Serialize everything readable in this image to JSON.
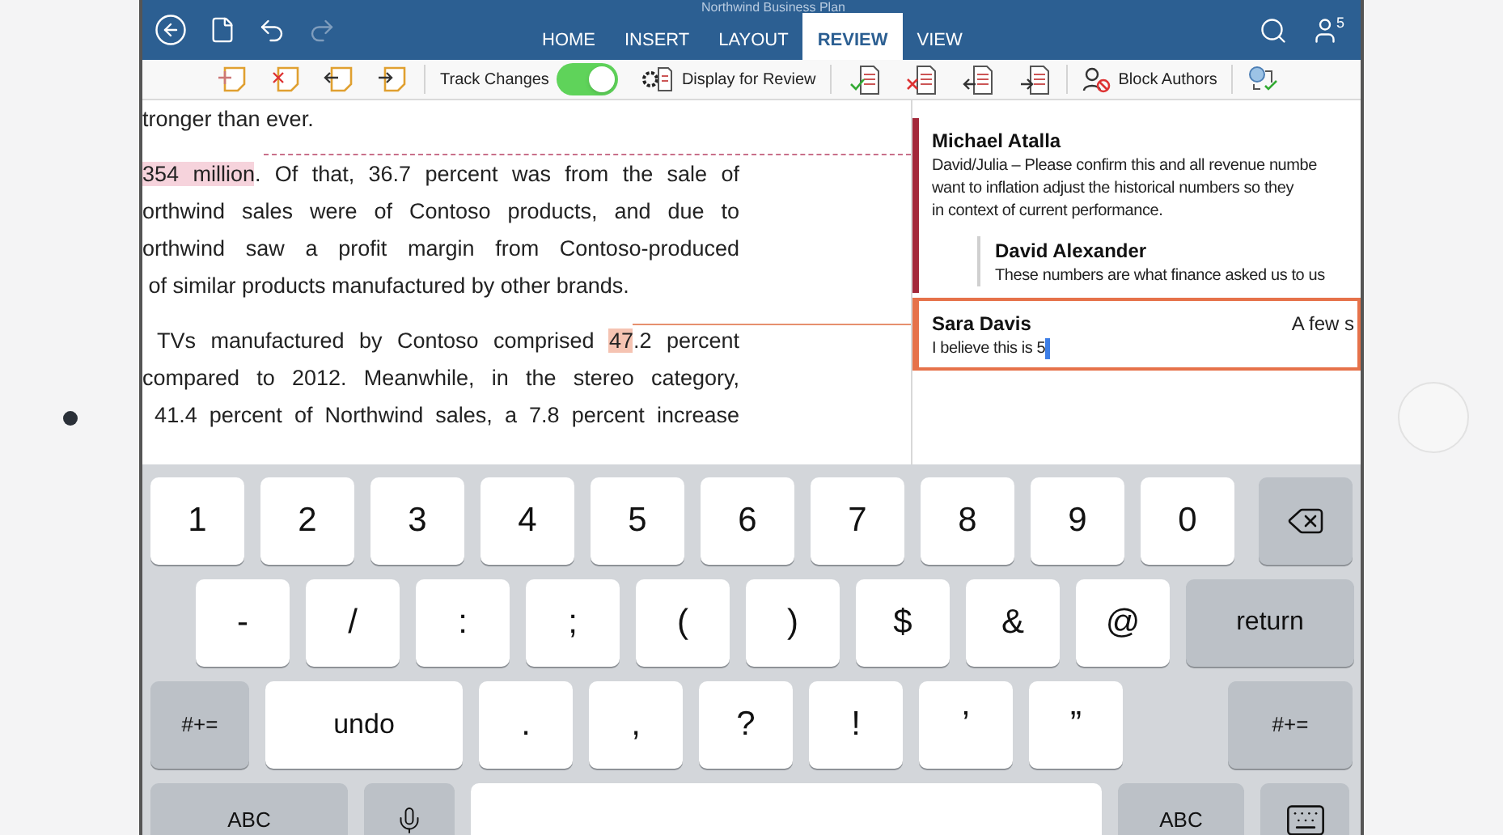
{
  "window": {
    "title": "Northwind Business Plan",
    "collaborators_count": "5"
  },
  "tabs": [
    {
      "label": "HOME",
      "selected": false
    },
    {
      "label": "INSERT",
      "selected": false
    },
    {
      "label": "LAYOUT",
      "selected": false
    },
    {
      "label": "REVIEW",
      "selected": true
    },
    {
      "label": "VIEW",
      "selected": false
    }
  ],
  "ribbon": {
    "track_changes": {
      "label": "Track Changes",
      "on": true
    },
    "display_for_review": {
      "label": "Display for Review"
    },
    "block_authors": {
      "label": "Block Authors"
    }
  },
  "document": {
    "paragraphs": [
      {
        "ends": true,
        "lines": [
          [
            {
              "text": "tronger than ever."
            }
          ]
        ]
      },
      {
        "ends": true,
        "lines": [
          [
            {
              "text": "354 million",
              "color": "#f6d3dc"
            },
            {
              "text": ". Of that, 36.7 percent was from the sale of"
            }
          ],
          [
            {
              "text": "orthwind sales were of Contoso products, and due to"
            }
          ],
          [
            {
              "text": "orthwind saw a profit margin from Contoso-produced"
            }
          ],
          [
            {
              "text": " of similar products manufactured by other brands."
            }
          ]
        ]
      },
      {
        "ends": false,
        "lines": [
          [
            {
              "text": " TVs manufactured by Contoso comprised "
            },
            {
              "text": "47",
              "color": "#f5c3b2"
            },
            {
              "text": ".2 percent"
            }
          ],
          [
            {
              "text": "compared to 2012. Meanwhile, in the stereo category,"
            }
          ],
          [
            {
              "text": " 41.4 percent of Northwind sales, a 7.8 percent increase"
            }
          ]
        ]
      }
    ]
  },
  "comments": [
    {
      "author": "Michael Atalla",
      "color": "#a3283a",
      "selected": false,
      "lines": [
        "David/Julia – Please confirm this and all revenue numbe",
        "want to inflation adjust the historical numbers so they",
        "in context of current performance."
      ],
      "replies": [
        {
          "author": "David Alexander",
          "lines": [
            "These numbers are what finance asked us to us"
          ]
        }
      ]
    },
    {
      "author": "Sara Davis",
      "color": "#e6724a",
      "selected": true,
      "time": "A few s",
      "lines": [
        "I believe this is 5"
      ]
    }
  ],
  "keyboard": {
    "rows": [
      [
        {
          "kind": "char",
          "label": "1"
        },
        {
          "kind": "char",
          "label": "2"
        },
        {
          "kind": "char",
          "label": "3"
        },
        {
          "kind": "char",
          "label": "4"
        },
        {
          "kind": "char",
          "label": "5"
        },
        {
          "kind": "char",
          "label": "6"
        },
        {
          "kind": "char",
          "label": "7"
        },
        {
          "kind": "char",
          "label": "8"
        },
        {
          "kind": "char",
          "label": "9"
        },
        {
          "kind": "char",
          "label": "0"
        },
        {
          "kind": "delete"
        }
      ],
      [
        {
          "kind": "char",
          "label": "-"
        },
        {
          "kind": "char",
          "label": "/"
        },
        {
          "kind": "char",
          "label": ":"
        },
        {
          "kind": "char",
          "label": ";"
        },
        {
          "kind": "char",
          "label": "("
        },
        {
          "kind": "char",
          "label": ")"
        },
        {
          "kind": "char",
          "label": "$"
        },
        {
          "kind": "char",
          "label": "&"
        },
        {
          "kind": "char",
          "label": "@"
        },
        {
          "kind": "function",
          "label": "return"
        }
      ],
      [
        {
          "kind": "function",
          "label": "#+="
        },
        {
          "kind": "char",
          "label": "undo"
        },
        {
          "kind": "char",
          "label": "."
        },
        {
          "kind": "char",
          "label": ","
        },
        {
          "kind": "char",
          "label": "?"
        },
        {
          "kind": "char",
          "label": "!"
        },
        {
          "kind": "char",
          "label": "’"
        },
        {
          "kind": "char",
          "label": "”"
        },
        {
          "kind": "function",
          "label": "#+="
        }
      ],
      [
        {
          "kind": "function",
          "label": "ABC"
        },
        {
          "kind": "mic"
        },
        {
          "kind": "space"
        },
        {
          "kind": "function",
          "label": "ABC"
        },
        {
          "kind": "hide"
        }
      ]
    ]
  }
}
